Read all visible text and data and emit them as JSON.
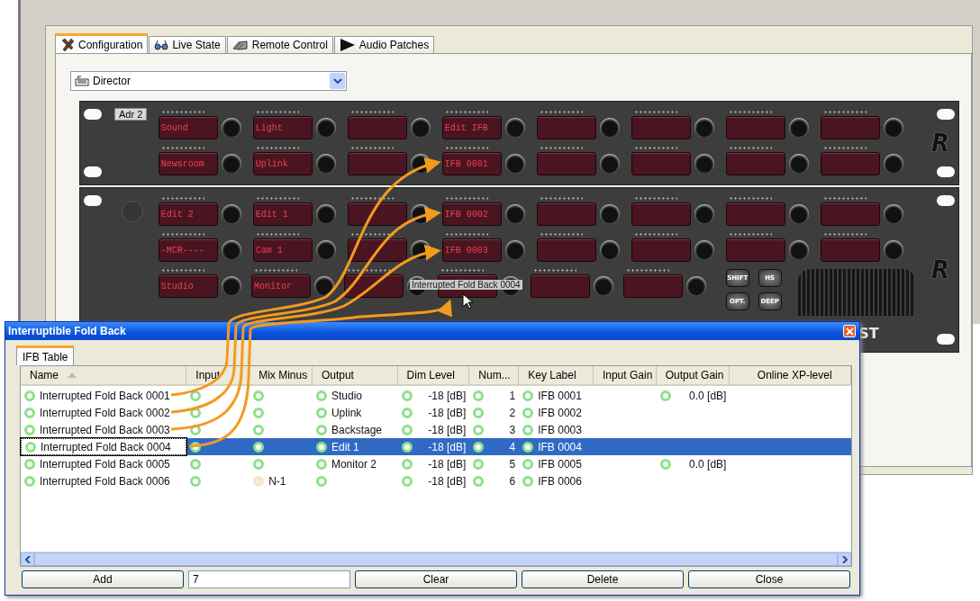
{
  "window": {
    "tabs": [
      {
        "label": "Configuration",
        "selected": true
      },
      {
        "label": "Live State",
        "selected": false
      },
      {
        "label": "Remote Control",
        "selected": false
      },
      {
        "label": "Audio Patches",
        "selected": false
      }
    ],
    "panel_selector": {
      "value": "Director"
    }
  },
  "rack": {
    "address": "Adr 2",
    "brand_text": "ST",
    "tooltip": "Interrupted Fold Back 0004",
    "function_keys": [
      "SHIFT",
      "HS",
      "OPT.",
      "DEEP"
    ],
    "units": [
      {
        "logo": "R",
        "rows": [
          {
            "keys": [
              {
                "kind": "label",
                "label": "Sound"
              },
              {
                "kind": "label",
                "label": "Light"
              },
              {
                "kind": "blank"
              },
              {
                "kind": "label",
                "label": "Edit IFB"
              },
              {
                "kind": "blank"
              },
              {
                "kind": "blank"
              },
              {
                "kind": "blank"
              },
              {
                "kind": "blank"
              }
            ]
          },
          {
            "keys": [
              {
                "kind": "label",
                "label": "Newsroom"
              },
              {
                "kind": "label",
                "label": "Uplink"
              },
              {
                "kind": "blank"
              },
              {
                "kind": "label",
                "label": "IFB 0001"
              },
              {
                "kind": "blank"
              },
              {
                "kind": "blank"
              },
              {
                "kind": "blank"
              },
              {
                "kind": "blank"
              }
            ]
          }
        ]
      },
      {
        "logo": "R",
        "rows": [
          {
            "keys": [
              {
                "kind": "label",
                "label": "Edit 2"
              },
              {
                "kind": "label",
                "label": "Edit 1"
              },
              {
                "kind": "blank"
              },
              {
                "kind": "label",
                "label": "IFB 0002"
              },
              {
                "kind": "blank"
              },
              {
                "kind": "blank"
              },
              {
                "kind": "blank"
              },
              {
                "kind": "blank"
              }
            ]
          },
          {
            "keys": [
              {
                "kind": "label",
                "label": "-MCR----"
              },
              {
                "kind": "label",
                "label": "Cam 1"
              },
              {
                "kind": "blank"
              },
              {
                "kind": "label",
                "label": "IFB 0003"
              },
              {
                "kind": "blank"
              },
              {
                "kind": "blank"
              },
              {
                "kind": "blank"
              },
              {
                "kind": "blank"
              }
            ]
          },
          {
            "keys": [
              {
                "kind": "label",
                "label": "Studio"
              },
              {
                "kind": "label",
                "label": "Monitor"
              },
              {
                "kind": "blank"
              },
              {
                "kind": "blank"
              },
              {
                "kind": "blank"
              },
              {
                "kind": "blank"
              }
            ]
          }
        ]
      }
    ]
  },
  "dialog": {
    "title": "Interruptible Fold Back",
    "tabs": [
      {
        "label": "IFB Table",
        "selected": true
      }
    ],
    "table": {
      "columns": [
        {
          "label": "Name",
          "sorted": true
        },
        {
          "label": "Input",
          "sorted": false
        },
        {
          "label": "Mix Minus",
          "sorted": false
        },
        {
          "label": "Output",
          "sorted": false
        },
        {
          "label": "Dim Level",
          "sorted": false
        },
        {
          "label": "Num...",
          "sorted": false
        },
        {
          "label": "Key Label",
          "sorted": false
        },
        {
          "label": "Input Gain",
          "sorted": false
        },
        {
          "label": "Output Gain",
          "sorted": false
        },
        {
          "label": "Online XP-level",
          "sorted": false
        }
      ],
      "rows": [
        {
          "name": "Interrupted Fold Back 0001",
          "name_on": true,
          "input_on": true,
          "mix_minus_on": true,
          "output": "Studio",
          "output_on": true,
          "dim_level": "-18 [dB]",
          "dim_on": true,
          "num": "1",
          "num_on": true,
          "key_label": "IFB 0001",
          "key_on": true,
          "output_gain": "0.0 [dB]",
          "selected": false
        },
        {
          "name": "Interrupted Fold Back 0002",
          "name_on": true,
          "input_on": true,
          "mix_minus_on": true,
          "output": "Uplink",
          "output_on": true,
          "dim_level": "-18 [dB]",
          "dim_on": true,
          "num": "2",
          "num_on": true,
          "key_label": "IFB 0002",
          "key_on": true,
          "selected": false
        },
        {
          "name": "Interrupted Fold Back 0003",
          "name_on": true,
          "input_on": true,
          "mix_minus_on": true,
          "output": "Backstage",
          "output_on": true,
          "dim_level": "-18 [dB]",
          "dim_on": true,
          "num": "3",
          "num_on": true,
          "key_label": "IFB 0003",
          "key_on": true,
          "selected": false
        },
        {
          "name": "Interrupted Fold Back 0004",
          "name_on": true,
          "input_on": true,
          "mix_minus_on": true,
          "output": "Edit 1",
          "output_on": true,
          "dim_level": "-18 [dB]",
          "dim_on": true,
          "num": "4",
          "num_on": true,
          "key_label": "IFB 0004",
          "key_on": true,
          "selected": true
        },
        {
          "name": "Interrupted Fold Back 0005",
          "name_on": true,
          "input_on": true,
          "mix_minus_on": true,
          "output": "Monitor 2",
          "output_on": true,
          "dim_level": "-18 [dB]",
          "dim_on": true,
          "num": "5",
          "num_on": true,
          "key_label": "IFB 0005",
          "key_on": true,
          "output_gain": "0.0 [dB]",
          "selected": false
        },
        {
          "name": "Interrupted Fold Back 0006",
          "name_on": true,
          "input_on": true,
          "mix_minus_on": false,
          "mix_minus": "N-1",
          "output_on": true,
          "dim_level": "-18 [dB]",
          "dim_on": true,
          "num": "6",
          "num_on": true,
          "key_label": "IFB 0006",
          "key_on": true,
          "selected": false
        }
      ]
    },
    "footer": [
      {
        "kind": "button",
        "label": "Add"
      },
      {
        "kind": "field",
        "value": "7"
      },
      {
        "kind": "button",
        "label": "Clear"
      },
      {
        "kind": "button",
        "label": "Delete"
      },
      {
        "kind": "button",
        "label": "Close"
      }
    ]
  }
}
